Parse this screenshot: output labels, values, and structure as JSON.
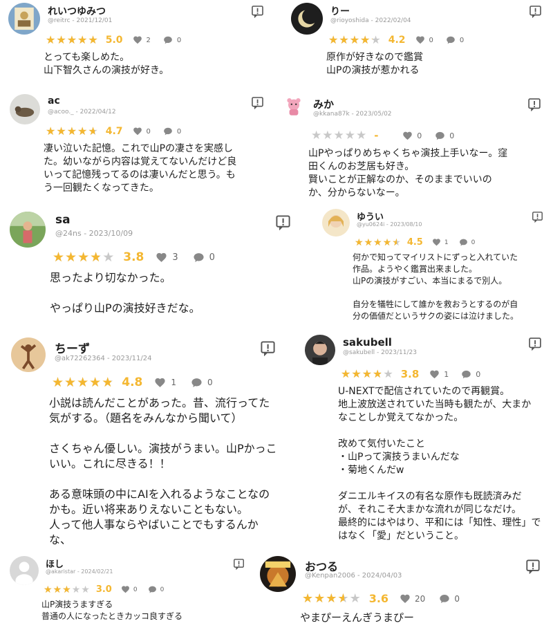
{
  "colors": {
    "star": "#f4b731",
    "star_empty": "#c8c8c8",
    "icon": "#888888",
    "meta": "#9a9a9a"
  },
  "reviews": [
    {
      "user": "れいつゆみつ",
      "handle": "@reitrc",
      "date": "2021/12/01",
      "rating": 5.0,
      "rating_text": "5.0",
      "likes": "2",
      "comments": "0",
      "text": "とっても楽しめた。\n山下智久さんの演技が好き。",
      "avatar": "artwork-avatar-icon"
    },
    {
      "user": "りー",
      "handle": "@rioyoshida",
      "date": "2022/02/04",
      "rating": 4.2,
      "rating_text": "4.2",
      "likes": "0",
      "comments": "0",
      "text": "原作が好きなので鑑賞\n山Pの演技が惹かれる",
      "avatar": "moon-avatar-icon"
    },
    {
      "user": "ac",
      "handle": "@acoo._",
      "date": "2022/04/12",
      "rating": 4.7,
      "rating_text": "4.7",
      "likes": "0",
      "comments": "0",
      "text": "凄い泣いた記憶。これで山Pの凄さを実感し\nた。幼いながら内容は覚えてないんだけど良\nいって記憶残ってるのは凄いんだと思う。も\nう一回観たくなってきた。",
      "avatar": "animal-avatar-icon"
    },
    {
      "user": "みか",
      "handle": "@kkana87k",
      "date": "2023/05/02",
      "rating": 0,
      "rating_text": "-",
      "likes": "0",
      "comments": "0",
      "text": "山Pやっぱりめちゃくちゃ演技上手いなー。窪\n田くんのお芝居も好き。\n賢いことが正解なのか、そのままでいいの\nか、分からないなー。",
      "avatar": "pink-character-avatar-icon"
    },
    {
      "user": "sa",
      "handle": "@24ns",
      "date": "2023/10/09",
      "rating": 3.8,
      "rating_text": "3.8",
      "likes": "3",
      "comments": "0",
      "text": "思ったより切なかった。\n\nやっぱり山Pの演技好きだな。",
      "avatar": "child-photo-avatar-icon"
    },
    {
      "user": "ゆうい",
      "handle": "@yu0624i",
      "date": "2023/08/10",
      "rating": 4.5,
      "rating_text": "4.5",
      "likes": "1",
      "comments": "0",
      "text": "何かで知ってマイリストにずっと入れていた\n作品。ようやく鑑賞出来ました。\n山Pの演技がすごい、本当にまるで別人。\n\n自分を犠牲にして誰かを救おうとするのが自\n分の価値だというサクの姿には泣けました。",
      "avatar": "illustration-avatar-icon"
    },
    {
      "user": "ちーず",
      "handle": "@ak72262364",
      "date": "2023/11/24",
      "rating": 4.8,
      "rating_text": "4.8",
      "likes": "1",
      "comments": "0",
      "text": "小説は読んだことがあった。昔、流行ってた\n気がする。（題名をみんなから聞いて）\n\nさくちゃん優しい。演技がうまい。山Pかっこ\nいい。これに尽きる！！\n\nある意味頭の中にAIを入れるようなことなの\nかも。近い将来ありえないこともない。\n人って他人事ならやばいことでもするんか\nな、",
      "avatar": "figure-photo-avatar-icon"
    },
    {
      "user": "sakubell",
      "handle": "@sakubell",
      "date": "2023/11/23",
      "rating": 3.8,
      "rating_text": "3.8",
      "likes": "1",
      "comments": "0",
      "text": "U-NEXTで配信されていたので再観賞。\n地上波放送されていた当時も観たが、大まか\nなことしか覚えてなかった。\n\n改めて気付いたこと\n・山Pって演技うまいんだな\n・菊地くんだw\n\nダニエルキイスの有名な原作も既読済みだ\nが、それこそ大まかな流れが同じなだけ。\n最終的にはやはり、平和には「知性、理性」で\nはなく「愛」だということ。",
      "avatar": "person-photo-avatar-icon"
    },
    {
      "user": "ほし",
      "handle": "@akaristar",
      "date": "2024/02/21",
      "rating": 3.0,
      "rating_text": "3.0",
      "likes": "0",
      "comments": "0",
      "text": "山P演技うますぎる\n普通の人になったときカッコ良すぎる",
      "avatar": "default-user-avatar-icon"
    },
    {
      "user": "おつる",
      "handle": "@Kenpan2006",
      "date": "2024/04/03",
      "rating": 3.6,
      "rating_text": "3.6",
      "likes": "20",
      "comments": "0",
      "text": "やまぴーえんぎうまぴー",
      "avatar": "poster-avatar-icon"
    }
  ]
}
